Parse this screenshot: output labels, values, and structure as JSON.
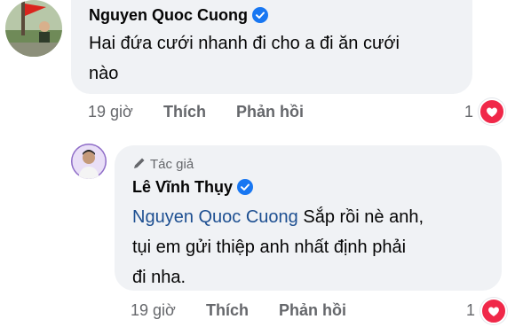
{
  "comment1": {
    "author": "Nguyen Quoc Cuong",
    "line1": "Hai đứa cưới nhanh đi cho a đi ăn cưới",
    "line2": "nào",
    "time": "19 giờ",
    "like_label": "Thích",
    "reply_label": "Phản hồi",
    "reaction_count": "1",
    "reaction_icon": "heart-icon"
  },
  "comment2": {
    "author_badge": "Tác giả",
    "author": "Lê Vĩnh Thụy",
    "mention": "Nguyen Quoc Cuong",
    "line1_rest": " Sắp rồi nè anh,",
    "line2": "tụi em gửi thiệp anh nhất định phải",
    "line3": "đi nha.",
    "time": "19 giờ",
    "like_label": "Thích",
    "reply_label": "Phản hồi",
    "reaction_count": "1",
    "reaction_icon": "heart-icon"
  },
  "colors": {
    "bubble": "#f0f2f5",
    "mention": "#1d4f91",
    "verified": "#1877f2",
    "heart": "#f02849",
    "meta_text": "#65676b"
  }
}
